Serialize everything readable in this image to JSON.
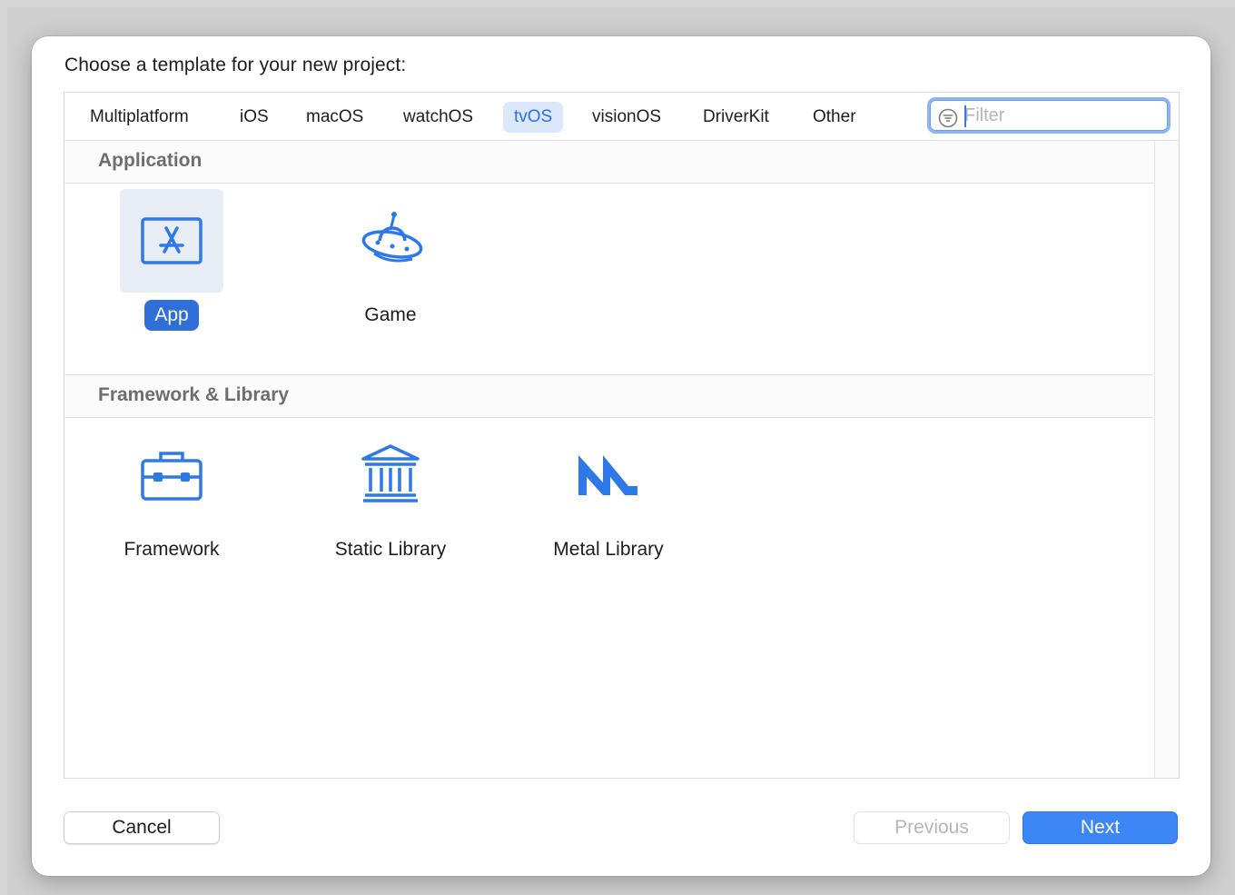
{
  "dialog": {
    "prompt": "Choose a template for your new project:"
  },
  "tabs": [
    {
      "label": "Multiplatform",
      "selected": false
    },
    {
      "label": "iOS",
      "selected": false
    },
    {
      "label": "macOS",
      "selected": false
    },
    {
      "label": "watchOS",
      "selected": false
    },
    {
      "label": "tvOS",
      "selected": true
    },
    {
      "label": "visionOS",
      "selected": false
    },
    {
      "label": "DriverKit",
      "selected": false
    },
    {
      "label": "Other",
      "selected": false
    }
  ],
  "filter": {
    "placeholder": "Filter",
    "value": "",
    "icon": "filter-icon"
  },
  "sections": [
    {
      "title": "Application",
      "templates": [
        {
          "label": "App",
          "icon": "app-store-icon",
          "selected": true
        },
        {
          "label": "Game",
          "icon": "ufo-game-icon",
          "selected": false
        }
      ]
    },
    {
      "title": "Framework & Library",
      "templates": [
        {
          "label": "Framework",
          "icon": "toolbox-icon",
          "selected": false
        },
        {
          "label": "Static Library",
          "icon": "library-building-icon",
          "selected": false
        },
        {
          "label": "Metal Library",
          "icon": "metal-icon",
          "selected": false
        }
      ]
    }
  ],
  "buttons": {
    "cancel": "Cancel",
    "previous": "Previous",
    "next": "Next"
  },
  "colors": {
    "accent": "#3d86f5",
    "icon_blue": "#2f78e8",
    "selected_tab_bg": "#dbe7fb",
    "selected_tab_text": "#2a6ee8"
  }
}
